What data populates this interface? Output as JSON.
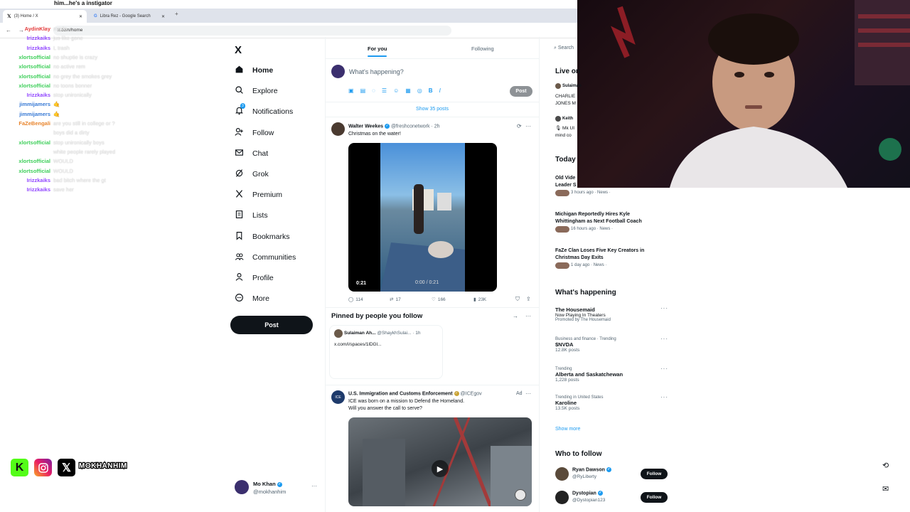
{
  "browser": {
    "tabs": [
      {
        "label": "(3) Home / X",
        "active": true
      },
      {
        "label": "Libra Rez - Google Search",
        "active": false
      }
    ],
    "new_tab": "+",
    "url": "x.com/home"
  },
  "stream": {
    "top_text": "him...he's a instigator",
    "chat": [
      {
        "user": "AydinKlay",
        "color": "#e33b3b",
        "msg": "rondo"
      },
      {
        "user": "Irizzkaiks",
        "color": "#9146ff",
        "msg": "jus like gone"
      },
      {
        "user": "Irizzkaiks",
        "color": "#9146ff",
        "msg": "L trash"
      },
      {
        "user": "xlortsofficial",
        "color": "#3ecf5a",
        "msg": "no shuptie is crazy"
      },
      {
        "user": "xlortsofficial",
        "color": "#3ecf5a",
        "msg": "no active rem"
      },
      {
        "user": "xlortsofficial",
        "color": "#3ecf5a",
        "msg": "no grey the smokes grey"
      },
      {
        "user": "xlortsofficial",
        "color": "#3ecf5a",
        "msg": "no toons bonner"
      },
      {
        "user": "Irizzkaiks",
        "color": "#9146ff",
        "msg": "stop unironically"
      },
      {
        "user": "jimmijamers",
        "color": "#3a7bd5",
        "msg": "🤙"
      },
      {
        "user": "jimmijamers",
        "color": "#3a7bd5",
        "msg": "🤙"
      },
      {
        "user": "FaZeBengali",
        "color": "#e8842c",
        "msg": "are you still in college or ?"
      },
      {
        "user": "",
        "color": "#e8842c",
        "msg": "boys did a dirty"
      },
      {
        "user": "xlortsofficial",
        "color": "#3ecf5a",
        "msg": "stop unironically boys"
      },
      {
        "user": "",
        "color": "#3ecf5a",
        "msg": "white people rarely played"
      },
      {
        "user": "xlortsofficial",
        "color": "#3ecf5a",
        "msg": "WOULD"
      },
      {
        "user": "xlortsofficial",
        "color": "#3ecf5a",
        "msg": "WOULD"
      },
      {
        "user": "Irizzkaiks",
        "color": "#9146ff",
        "msg": "bad bitch where the gt"
      },
      {
        "user": "Irizzkaiks",
        "color": "#9146ff",
        "msg": "save her"
      }
    ],
    "socials_handle": "MOKHANHIM"
  },
  "nav": {
    "logo": "X",
    "items": [
      {
        "label": "Home",
        "icon": "home-icon"
      },
      {
        "label": "Explore",
        "icon": "search-icon"
      },
      {
        "label": "Notifications",
        "icon": "bell-icon",
        "badge": "3"
      },
      {
        "label": "Follow",
        "icon": "person-plus-icon"
      },
      {
        "label": "Chat",
        "icon": "mail-icon"
      },
      {
        "label": "Grok",
        "icon": "grok-icon"
      },
      {
        "label": "Premium",
        "icon": "x-icon"
      },
      {
        "label": "Lists",
        "icon": "list-icon"
      },
      {
        "label": "Bookmarks",
        "icon": "bookmark-icon"
      },
      {
        "label": "Communities",
        "icon": "people-icon"
      },
      {
        "label": "Profile",
        "icon": "person-icon"
      },
      {
        "label": "More",
        "icon": "more-circle-icon"
      }
    ],
    "post_label": "Post",
    "account": {
      "name": "Mo Khan",
      "handle": "@mokhanhim",
      "more": "···"
    }
  },
  "feed": {
    "tabs": [
      "For you",
      "Following"
    ],
    "composer": {
      "placeholder": "What's happening?",
      "post_label": "Post"
    },
    "show_posts": "Show 35 posts",
    "tweet": {
      "name": "Walter Weekes",
      "handle": "@freshconetwork",
      "time": "· 2h",
      "text": "Christmas on the water!",
      "video_time": "0:21",
      "player_time": "0:00 / 0:21",
      "replies": "114",
      "reposts": "17",
      "likes": "166",
      "views": "23K"
    },
    "pinned": {
      "title": "Pinned by people you follow",
      "name": "Sulaiman Ah...",
      "handle": "@ShaykhSulai...",
      "time": "· 1h",
      "text": "x.com/i/spaces/1lDGl..."
    },
    "ad": {
      "name": "U.S. Immigration and Customs Enforcement",
      "handle": "@ICEgov",
      "ad_label": "Ad",
      "line1": "ICE was born on a mission to Defend the Homeland.",
      "line2": "Will you answer the call to serve?"
    }
  },
  "right": {
    "search_placeholder": "Search",
    "live_title": "Live on",
    "live_items": [
      {
        "user": "Sulaiman",
        "text": "CHARLIE",
        "text2": "JONES M"
      },
      {
        "user": "Keith",
        "text": "🎙 Mk UI",
        "text2": "mind co"
      }
    ],
    "today_title": "Today",
    "news": [
      {
        "title": "Old Vide",
        "title2": "Leader S",
        "meta": "3 hours ago · News ·"
      },
      {
        "title": "Michigan Reportedly Hires Kyle",
        "title2": "Whittingham as Next Football Coach",
        "meta": "16 hours ago · News ·"
      },
      {
        "title": "FaZe Clan Loses Five Key Creators in",
        "title2": "Christmas Day Exits",
        "meta": "1 day ago · News ·"
      }
    ],
    "happening_title": "What's happening",
    "trends": [
      {
        "small": "",
        "big": "The Housemaid",
        "sub": "Now Playing In Theaters",
        "sub2": "Promoted by The Housemaid"
      },
      {
        "small": "Business and finance · Trending",
        "big": "$NVDA",
        "sub": "12.8K posts",
        "sub2": ""
      },
      {
        "small": "Trending",
        "big": "Alberta and Saskatchewan",
        "sub": "1,228 posts",
        "sub2": ""
      },
      {
        "small": "Trending in United States",
        "big": "Karoline",
        "sub": "13.5K posts",
        "sub2": ""
      }
    ],
    "show_more": "Show more",
    "who_title": "Who to follow",
    "who": [
      {
        "name": "Ryan Dawson",
        "handle": "@RyLiberty",
        "button": "Follow"
      },
      {
        "name": "Dystopian",
        "handle": "@Dystopian123",
        "button": "Follow"
      }
    ]
  },
  "colors": {
    "accent": "#1d9bf0",
    "text": "#0f1419",
    "muted": "#536471"
  }
}
